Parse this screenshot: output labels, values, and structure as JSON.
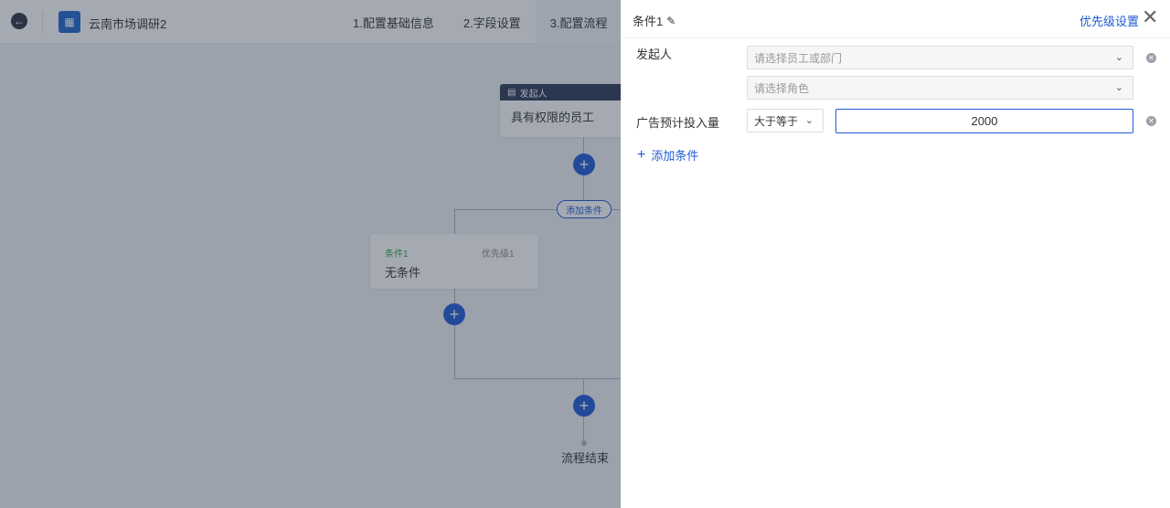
{
  "header": {
    "back_icon": "arrow-left-icon",
    "app_icon": "form-icon",
    "app_title": "云南市场调研2",
    "steps": [
      "1.配置基础信息",
      "2.字段设置",
      "3.配置流程"
    ]
  },
  "flow": {
    "starter_label": "发起人",
    "starter_desc": "具有权限的员工",
    "add_condition": "添加条件",
    "branch": {
      "name": "条件1",
      "priority": "优先级1",
      "desc": "无条件"
    },
    "end_label": "流程结束"
  },
  "panel": {
    "title": "条件1",
    "priority_link": "优先级设置",
    "rows": [
      {
        "label": "发起人",
        "placeholder1": "请选择员工或部门",
        "placeholder2": "请选择角色"
      },
      {
        "label": "广告预计投入量",
        "operator": "大于等于",
        "value": "2000"
      }
    ],
    "add_condition": "添加条件"
  },
  "colors": {
    "primary": "#1f5bd6",
    "condition_green": "#36a24a",
    "starter_bar": "#2b3a55"
  }
}
